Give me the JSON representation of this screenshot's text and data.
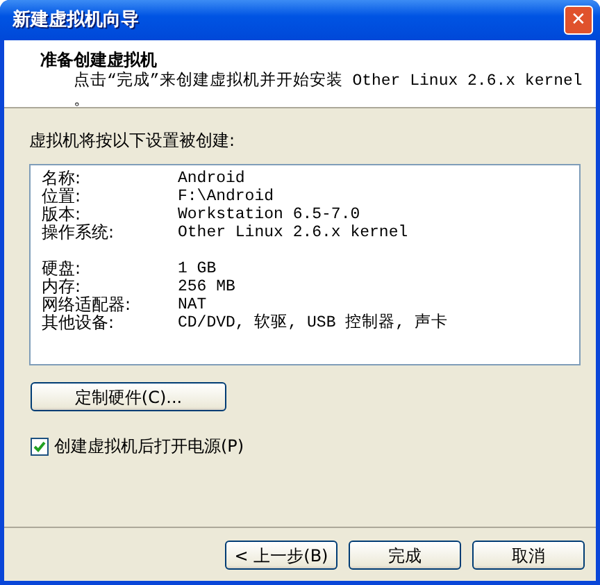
{
  "window": {
    "title": "新建虚拟机向导",
    "close": "✕"
  },
  "header": {
    "title": "准备创建虚拟机",
    "description": "点击“完成”来创建虚拟机并开始安装 Other Linux 2.6.x kernel 。"
  },
  "intro": "虚拟机将按以下设置被创建:",
  "summary": [
    [
      {
        "label": "名称:",
        "value": "Android"
      },
      {
        "label": "位置:",
        "value": "F:\\Android"
      },
      {
        "label": "版本:",
        "value": "Workstation 6.5-7.0"
      },
      {
        "label": "操作系统:",
        "value": "Other Linux 2.6.x kernel"
      }
    ],
    [
      {
        "label": "硬盘:",
        "value": "1 GB"
      },
      {
        "label": "内存:",
        "value": "256 MB"
      },
      {
        "label": "网络适配器:",
        "value": "NAT"
      },
      {
        "label": "其他设备:",
        "value": "CD/DVD, 软驱, USB 控制器, 声卡"
      }
    ]
  ],
  "customize_button": "定制硬件(C)...",
  "power_on": {
    "label": "创建虚拟机后打开电源(P)",
    "checked": true
  },
  "buttons": [
    {
      "label": "< 上一步(B)",
      "kind": "back"
    },
    {
      "label": "完成",
      "kind": "finish"
    },
    {
      "label": "取消",
      "kind": "cancel"
    }
  ]
}
